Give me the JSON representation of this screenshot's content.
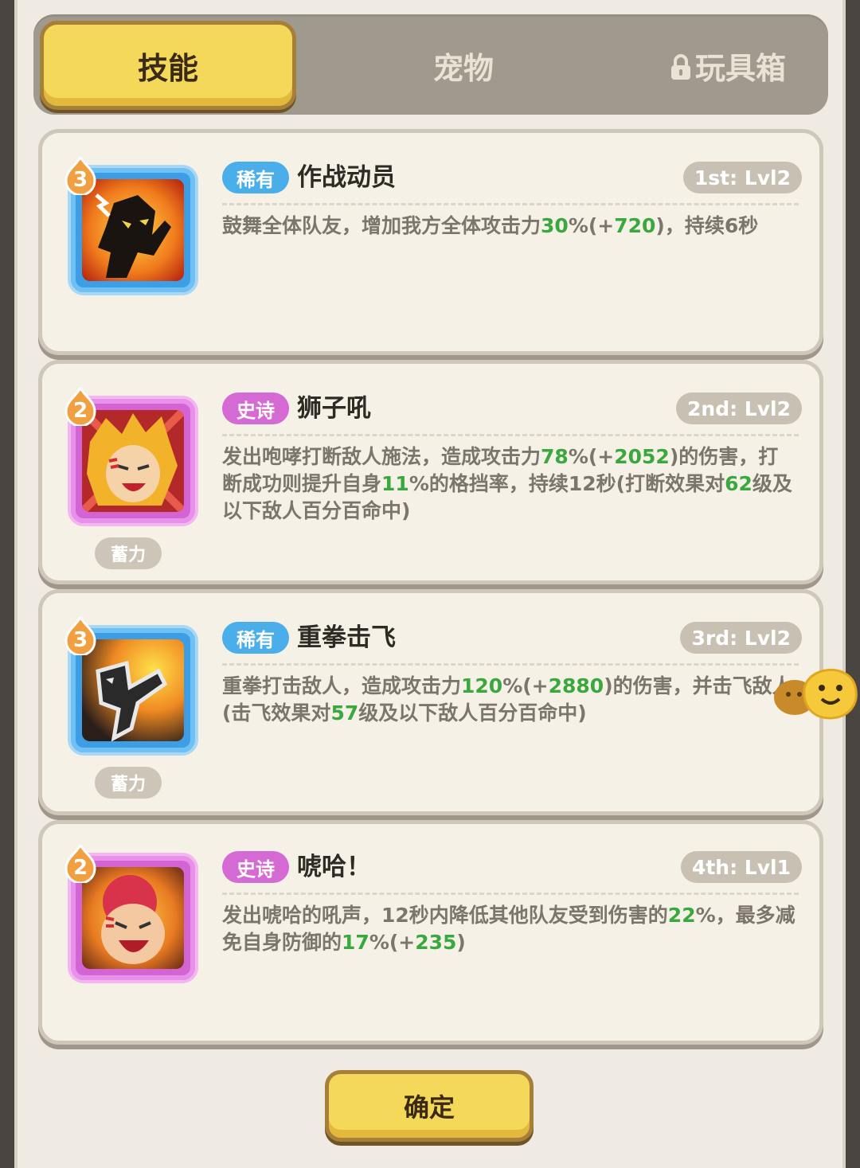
{
  "tabs": {
    "skills": "技能",
    "pets": "宠物",
    "toybox": "玩具箱"
  },
  "skills": [
    {
      "badge_level": "3",
      "rarity": "稀有",
      "name": "作战动员",
      "slot": "1st: Lvl2",
      "desc": [
        {
          "t": "鼓舞全体队友，增加我方全体攻击力"
        },
        {
          "t": "30",
          "g": true
        },
        {
          "t": "%(+"
        },
        {
          "t": "720",
          "g": true
        },
        {
          "t": ")，持续6秒"
        }
      ]
    },
    {
      "badge_level": "2",
      "rarity": "史诗",
      "name": "狮子吼",
      "slot": "2nd: Lvl2",
      "charge": "蓄力",
      "desc": [
        {
          "t": "发出咆哮打断敌人施法，造成攻击力"
        },
        {
          "t": "78",
          "g": true
        },
        {
          "t": "%(+"
        },
        {
          "t": "2052",
          "g": true
        },
        {
          "t": ")的伤害，打断成功则提升自身"
        },
        {
          "t": "11",
          "g": true
        },
        {
          "t": "%的格挡率，持续12秒(打断效果对"
        },
        {
          "t": "62",
          "g": true
        },
        {
          "t": "级及以下敌人百分百命中)"
        }
      ]
    },
    {
      "badge_level": "3",
      "rarity": "稀有",
      "name": "重拳击飞",
      "slot": "3rd: Lvl2",
      "charge": "蓄力",
      "desc": [
        {
          "t": "重拳打击敌人，造成攻击力"
        },
        {
          "t": "120",
          "g": true
        },
        {
          "t": "%(+"
        },
        {
          "t": "2880",
          "g": true
        },
        {
          "t": ")的伤害，并击飞敌人(击飞效果对"
        },
        {
          "t": "57",
          "g": true
        },
        {
          "t": "级及以下敌人百分百命中)"
        }
      ]
    },
    {
      "badge_level": "2",
      "rarity": "史诗",
      "name": "唬哈！",
      "slot": "4th: Lvl1",
      "desc": [
        {
          "t": "发出唬哈的吼声，12秒内降低其他队友受到伤害的"
        },
        {
          "t": "22",
          "g": true
        },
        {
          "t": "%，最多减免自身防御的"
        },
        {
          "t": "17",
          "g": true
        },
        {
          "t": "%(+"
        },
        {
          "t": "235",
          "g": true
        },
        {
          "t": ")"
        }
      ]
    }
  ],
  "confirm_label": "确定",
  "colors": {
    "accent_yellow": "#f4d85a",
    "rare_blue": "#4aaeea",
    "epic_purple": "#d66ad4",
    "value_green": "#3aa83e"
  }
}
